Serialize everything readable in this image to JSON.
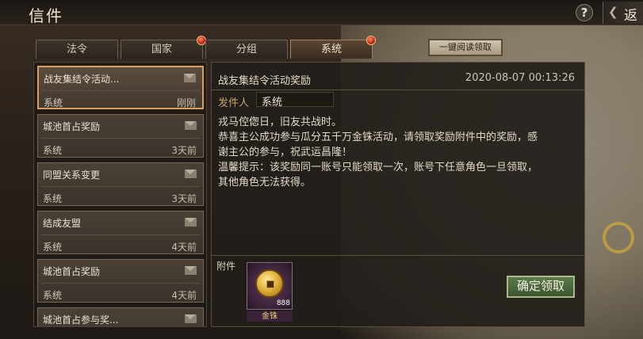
{
  "header": {
    "title": "信件",
    "help_label": "?",
    "back_label": "返"
  },
  "tabs": [
    {
      "label": "法令",
      "badge": false
    },
    {
      "label": "国家",
      "badge": true
    },
    {
      "label": "分组",
      "badge": false
    },
    {
      "label": "系统",
      "badge": true,
      "active": true
    }
  ],
  "claim_all_label": "一键阅读领取",
  "mail_list": [
    {
      "title": "战友集结令活动...",
      "sender": "系统",
      "time": "刚刚",
      "selected": true
    },
    {
      "title": "城池首占奖励",
      "sender": "系统",
      "time": "3天前"
    },
    {
      "title": "同盟关系变更",
      "sender": "系统",
      "time": "3天前"
    },
    {
      "title": "结成友盟",
      "sender": "系统",
      "time": "4天前"
    },
    {
      "title": "城池首占奖励",
      "sender": "系统",
      "time": "4天前"
    },
    {
      "title": "城池首占参与奖...",
      "sender": "",
      "time": ""
    }
  ],
  "detail": {
    "subject": "战友集结令活动奖励",
    "date": "2020-08-07 00:13:26",
    "sender_label": "发件人",
    "sender": "系统",
    "body": [
      "戎马倥偬日，旧友共战时。",
      "恭喜主公成功参与瓜分五千万金铢活动，请领取奖励附件中的奖励，感",
      "谢主公的参与，祝武运昌隆！",
      "温馨提示：该奖励同一账号只能领取一次，账号下任意角色一旦领取，",
      "其他角色无法获得。"
    ],
    "attachment_label": "附件",
    "attachment": {
      "name": "金铢",
      "quantity": "888"
    },
    "confirm_label": "确定领取"
  },
  "colors": {
    "accent_gold": "#d9a05a",
    "confirm_green": "#4a6a3c",
    "badge_red": "#c82a18"
  }
}
